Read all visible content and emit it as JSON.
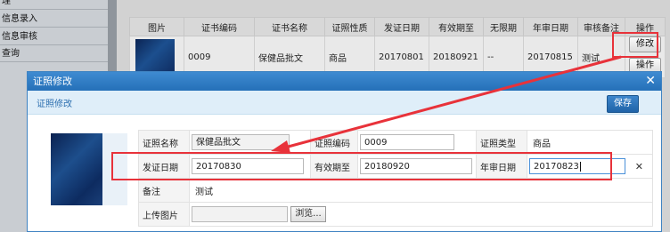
{
  "sidebar": {
    "items": [
      {
        "label": "理"
      },
      {
        "label": "信息录入"
      },
      {
        "label": "信息审核"
      },
      {
        "label": "查询"
      }
    ]
  },
  "table": {
    "headers": [
      "图片",
      "证书编码",
      "证书名称",
      "证照性质",
      "发证日期",
      "有效期至",
      "无限期",
      "年审日期",
      "审核备注",
      "操作"
    ],
    "row": {
      "code": "0009",
      "name": "保健品批文",
      "nature": "商品",
      "issue_date": "20170801",
      "valid_until": "20180921",
      "unlimited": "--",
      "annual_review": "20170815",
      "review_note": "测试"
    },
    "op_buttons": [
      "修改",
      "操作"
    ]
  },
  "modal": {
    "title": "证照修改",
    "subtitle": "证照修改",
    "save_label": "保存",
    "close_icon": "close-icon",
    "fields": {
      "cert_name_label": "证照名称",
      "cert_name_value": "保健品批文",
      "cert_code_label": "证照编码",
      "cert_code_value": "0009",
      "cert_type_label": "证照类型",
      "cert_type_value": "商品",
      "issue_date_label": "发证日期",
      "issue_date_value": "20170830",
      "valid_until_label": "有效期至",
      "valid_until_value": "20180920",
      "annual_review_label": "年审日期",
      "annual_review_value": "20170823",
      "remark_label": "备注",
      "remark_value": "测试",
      "upload_label": "上传图片",
      "browse_label": "浏览..."
    }
  },
  "colors": {
    "annotation_red": "#e8323a",
    "modal_blue": "#2570b8"
  }
}
